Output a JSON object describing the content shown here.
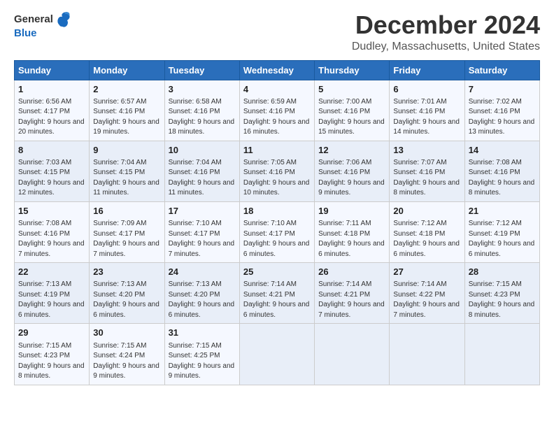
{
  "header": {
    "logo_line1": "General",
    "logo_line2": "Blue",
    "month": "December 2024",
    "location": "Dudley, Massachusetts, United States"
  },
  "weekdays": [
    "Sunday",
    "Monday",
    "Tuesday",
    "Wednesday",
    "Thursday",
    "Friday",
    "Saturday"
  ],
  "weeks": [
    [
      {
        "day": "1",
        "sunrise": "6:56 AM",
        "sunset": "4:17 PM",
        "daylight": "9 hours and 20 minutes."
      },
      {
        "day": "2",
        "sunrise": "6:57 AM",
        "sunset": "4:16 PM",
        "daylight": "9 hours and 19 minutes."
      },
      {
        "day": "3",
        "sunrise": "6:58 AM",
        "sunset": "4:16 PM",
        "daylight": "9 hours and 18 minutes."
      },
      {
        "day": "4",
        "sunrise": "6:59 AM",
        "sunset": "4:16 PM",
        "daylight": "9 hours and 16 minutes."
      },
      {
        "day": "5",
        "sunrise": "7:00 AM",
        "sunset": "4:16 PM",
        "daylight": "9 hours and 15 minutes."
      },
      {
        "day": "6",
        "sunrise": "7:01 AM",
        "sunset": "4:16 PM",
        "daylight": "9 hours and 14 minutes."
      },
      {
        "day": "7",
        "sunrise": "7:02 AM",
        "sunset": "4:16 PM",
        "daylight": "9 hours and 13 minutes."
      }
    ],
    [
      {
        "day": "8",
        "sunrise": "7:03 AM",
        "sunset": "4:15 PM",
        "daylight": "9 hours and 12 minutes."
      },
      {
        "day": "9",
        "sunrise": "7:04 AM",
        "sunset": "4:15 PM",
        "daylight": "9 hours and 11 minutes."
      },
      {
        "day": "10",
        "sunrise": "7:04 AM",
        "sunset": "4:16 PM",
        "daylight": "9 hours and 11 minutes."
      },
      {
        "day": "11",
        "sunrise": "7:05 AM",
        "sunset": "4:16 PM",
        "daylight": "9 hours and 10 minutes."
      },
      {
        "day": "12",
        "sunrise": "7:06 AM",
        "sunset": "4:16 PM",
        "daylight": "9 hours and 9 minutes."
      },
      {
        "day": "13",
        "sunrise": "7:07 AM",
        "sunset": "4:16 PM",
        "daylight": "9 hours and 8 minutes."
      },
      {
        "day": "14",
        "sunrise": "7:08 AM",
        "sunset": "4:16 PM",
        "daylight": "9 hours and 8 minutes."
      }
    ],
    [
      {
        "day": "15",
        "sunrise": "7:08 AM",
        "sunset": "4:16 PM",
        "daylight": "9 hours and 7 minutes."
      },
      {
        "day": "16",
        "sunrise": "7:09 AM",
        "sunset": "4:17 PM",
        "daylight": "9 hours and 7 minutes."
      },
      {
        "day": "17",
        "sunrise": "7:10 AM",
        "sunset": "4:17 PM",
        "daylight": "9 hours and 7 minutes."
      },
      {
        "day": "18",
        "sunrise": "7:10 AM",
        "sunset": "4:17 PM",
        "daylight": "9 hours and 6 minutes."
      },
      {
        "day": "19",
        "sunrise": "7:11 AM",
        "sunset": "4:18 PM",
        "daylight": "9 hours and 6 minutes."
      },
      {
        "day": "20",
        "sunrise": "7:12 AM",
        "sunset": "4:18 PM",
        "daylight": "9 hours and 6 minutes."
      },
      {
        "day": "21",
        "sunrise": "7:12 AM",
        "sunset": "4:19 PM",
        "daylight": "9 hours and 6 minutes."
      }
    ],
    [
      {
        "day": "22",
        "sunrise": "7:13 AM",
        "sunset": "4:19 PM",
        "daylight": "9 hours and 6 minutes."
      },
      {
        "day": "23",
        "sunrise": "7:13 AM",
        "sunset": "4:20 PM",
        "daylight": "9 hours and 6 minutes."
      },
      {
        "day": "24",
        "sunrise": "7:13 AM",
        "sunset": "4:20 PM",
        "daylight": "9 hours and 6 minutes."
      },
      {
        "day": "25",
        "sunrise": "7:14 AM",
        "sunset": "4:21 PM",
        "daylight": "9 hours and 6 minutes."
      },
      {
        "day": "26",
        "sunrise": "7:14 AM",
        "sunset": "4:21 PM",
        "daylight": "9 hours and 7 minutes."
      },
      {
        "day": "27",
        "sunrise": "7:14 AM",
        "sunset": "4:22 PM",
        "daylight": "9 hours and 7 minutes."
      },
      {
        "day": "28",
        "sunrise": "7:15 AM",
        "sunset": "4:23 PM",
        "daylight": "9 hours and 8 minutes."
      }
    ],
    [
      {
        "day": "29",
        "sunrise": "7:15 AM",
        "sunset": "4:23 PM",
        "daylight": "9 hours and 8 minutes."
      },
      {
        "day": "30",
        "sunrise": "7:15 AM",
        "sunset": "4:24 PM",
        "daylight": "9 hours and 9 minutes."
      },
      {
        "day": "31",
        "sunrise": "7:15 AM",
        "sunset": "4:25 PM",
        "daylight": "9 hours and 9 minutes."
      },
      null,
      null,
      null,
      null
    ]
  ]
}
